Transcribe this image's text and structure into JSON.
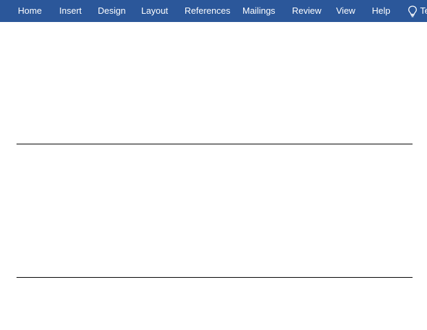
{
  "ribbon": {
    "tabs": [
      {
        "label": "Home"
      },
      {
        "label": "Insert"
      },
      {
        "label": "Design"
      },
      {
        "label": "Layout"
      },
      {
        "label": "References"
      },
      {
        "label": "Mailings"
      },
      {
        "label": "Review"
      },
      {
        "label": "View"
      },
      {
        "label": "Help"
      }
    ],
    "tell_me": {
      "icon": "lightbulb-icon",
      "label": "Tell me what you want to do"
    }
  },
  "colors": {
    "ribbon_background": "#2b579a",
    "ribbon_text": "#ffffff",
    "document_background": "#ffffff",
    "rule_color": "#000000"
  }
}
